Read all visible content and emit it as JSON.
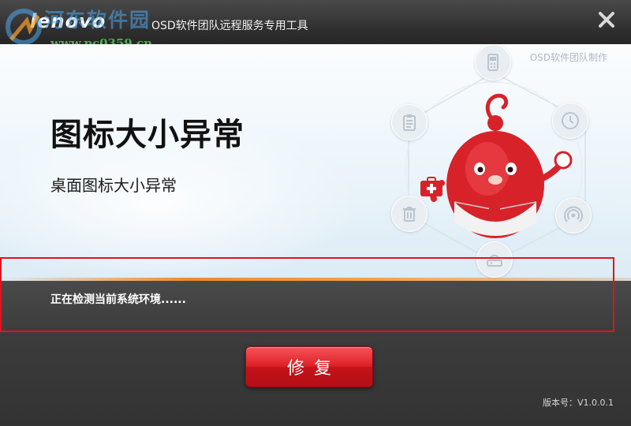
{
  "titlebar": {
    "brand": "lenovo",
    "app_title": "OSD软件团队远程服务专用工具",
    "close_icon": "close-icon"
  },
  "watermark": {
    "text": "河东软件园",
    "url": "www.pc0359.cn"
  },
  "banner": {
    "team_label": "OSD软件团队制作",
    "issue_title": "图标大小异常",
    "issue_subtitle": "桌面图标大小异常",
    "icons": [
      "phone-icon",
      "clock-icon",
      "wifi-icon",
      "router-icon",
      "trash-icon",
      "clipboard-icon",
      "medkit-icon",
      "magnifier-icon"
    ]
  },
  "status": {
    "text": "正在检测当前系统环境......"
  },
  "actions": {
    "repair_label": "修复"
  },
  "footer": {
    "version": "版本号：V1.0.0.1"
  },
  "colors": {
    "accent_red": "#e02027",
    "highlight_frame": "#e0141e",
    "titlebar": "#2e2e2e"
  }
}
